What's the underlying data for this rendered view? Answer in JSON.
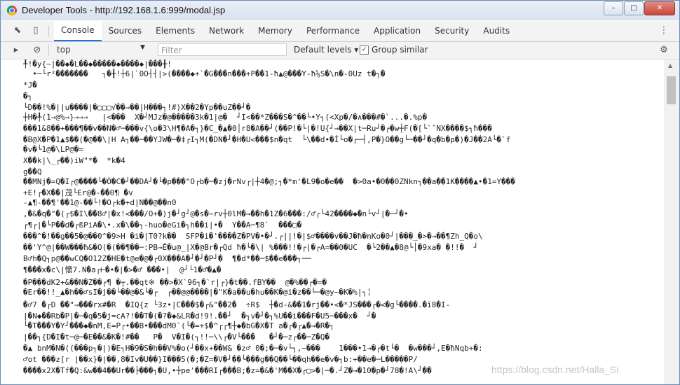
{
  "window": {
    "title": "Developer Tools - http://192.168.1.6:999/modal.jsp",
    "minimize": "–",
    "maximize": "□",
    "close": "✕"
  },
  "tabs": [
    "Console",
    "Sources",
    "Elements",
    "Network",
    "Memory",
    "Performance",
    "Application",
    "Security",
    "Audits"
  ],
  "active_tab": "Console",
  "consolebar": {
    "context": "top",
    "filter_placeholder": "Filter",
    "levels": "Default levels ▾",
    "group_similar_label": "Group similar",
    "group_similar_checked": true
  },
  "output_lines": [
    "╀!�y{~|��◆�L��◆�����◆����◆|���╂!",
    "  •─└r²�������   ┐�╂!┼6|`0O┤┤|>(����◆+`�G���n���+P��1-ħ▲@���Y-ħ⅝S�\\n�-0Uz t�┐�",
    "*J�",
    "�┐",
    "└D��!%�||u����|�▢▢▢√��⇒��|H���┐!#)X��2�Yp��uZ��┘�",
    "┼H�╀(1⇒@%⇒}⇒⇒⇒   |<���  X�┘MJz�@�����3k�1|@�  ┘I<��*Z���S�^��└•Y┐(<Xp�/�∧���#�`...�.%p�",
    "���1&8��+���¶��v��N�♂─���v{\\o�3\\H¶�A�┐}�C_�▲�0│r8�A��┘(��P!�└|�!U{┘→��X|t─Ru┘�┌�w┼F(�[└`ˆNX����$┐ħ���",
    "�B@X�P�1▲$��(�@��\\|H A┐��─��YJW�─�‡┌I┐M(�DN�┘�H�U<���$n�qt  └\\��d•�Í└o�┌─┤,P�}O��g└─��┘�q�b�p�)�J��2A└�`f",
    "�v�└1@�\\LP@�=",
    "X��k|\\_┌��)iW\"*�  *k�4",
    "g��Q",
    "��MNj�=Q�I┌@����└�Ò�C�┘��DA┘�└�p���\"O┌b�─�zj�rNv┌|┼4�@;┐�*m'�L9�o�e��  �>0a•�0��0ZNkn┐��a��1K����▲•�1=Y���",
    "+E!┌�X��|茂└Er@�-��0¶ �v",
    "-▲¶-��¶'��1@-��└!�O┌k�+d|N��@��n0",
    ",�&�q�\"�(┌$�I\\��8♂|�x!<���/O+�)j�┘g┘@�s�~rv┼0lM�→��h�1Z�6���:/♂┌└42����◆�n└v┘|�─┘�•",
    "┌¶┌|�└P��d�┌ßPiA�\\•.x�\\��┐-huo�eGi�┐h��i|•�  Y��A─¶8`  ���▢�",
    "���^�!��g��5�@��0^�9>H �i�|T0?k��  SFP�i�'����Z�PV�•�┘.┌||!�|$♂����v��J�ħ�nKo�0┘|���_�>�→��¶Zh_Q�o\\",
    "��'Y^@|��W���ħ&�O(�(��¶��─:PB→Ê�u@_|X�@Br�┌Qd ħ�└�\\| %���!!�┌|�┌A=��0�UC  �└2��▲�8@└│�9xa� �!!�  ┘",
    "B♂h�Q┐p@��wCQ�O12Z�HE�t@e�@�┌0X���A�┘�┘�P┘�  ¶�d*��─$��e���┐──",
    "¶���x�c\\|懷7.N�a┌⊢�•�|�>�♂ ���•|  @┘└1�♂�▲�",
    "�P���dK2+&��N�Z��┌¶ �┬.��qt※ ��>�X`96┐�`r|┌}�t��.fBY��  @�%��┌�=�",
    "�Er��!!_▲�h��♂sI�j��└��@�&└�┌  ┌��@@����|�\"K�a��u�hu��K�@i�z��└─�@y~�K�%|┐╎",
    "�♂7 �┌D ��\"⇒���rx#�R  �IQ{z └3z•|C���$�┌&\"��2�  ÷R$  ┼�d-&��1�rj��•<�*JS���┌�<�g└����.�ĭ8�I-",
    "|�N◆��Rb�P|�─�q�5�j=cA?!��T�(�?�◆&LR�d!9!.��┘  �┐v�┘�┐%U��i���F�U5─���x�  ┘�",
    "└�T���Y�Y┘���◆�nM,E=P┌•��B•���dM0`(└�=+$�^┌┌¶┼◆�bG�X�T a�┌�┌▲�→�R�┐",
    "|��┐{D�I�t─@─�E��&�K�!#��   P�  V�I�(┐!!─\\\\┌�V└���   �┘�─z┌��─Z�Q�",
    "�▲ bnM�N�((���p┐�|)�E┐H�9�S�h��V%�o(┘��x+��W& �z♂ 0�;�─�v└┐,~���    1���•1→�┌�t└�  �w���┘,E�ħNqb+�:",
    "♂ot ���z[r |��x}�|��,8�Iv�U��}I���5(�;�Z=�V�┘��└���g��Q��└��qh��e�v�┐b:+��e�─L�����P/",
    "����x2X�Tf�Q:&w��4��Ur��├���┐�U,•┼pe'���RI┌���B;�z=�&�'M��X�┌▢>�|─�.┘Z�→�10�p�┘78�!A\\┘��"
  ],
  "watermark": "https://blog.csdn.net/Halla_Si"
}
